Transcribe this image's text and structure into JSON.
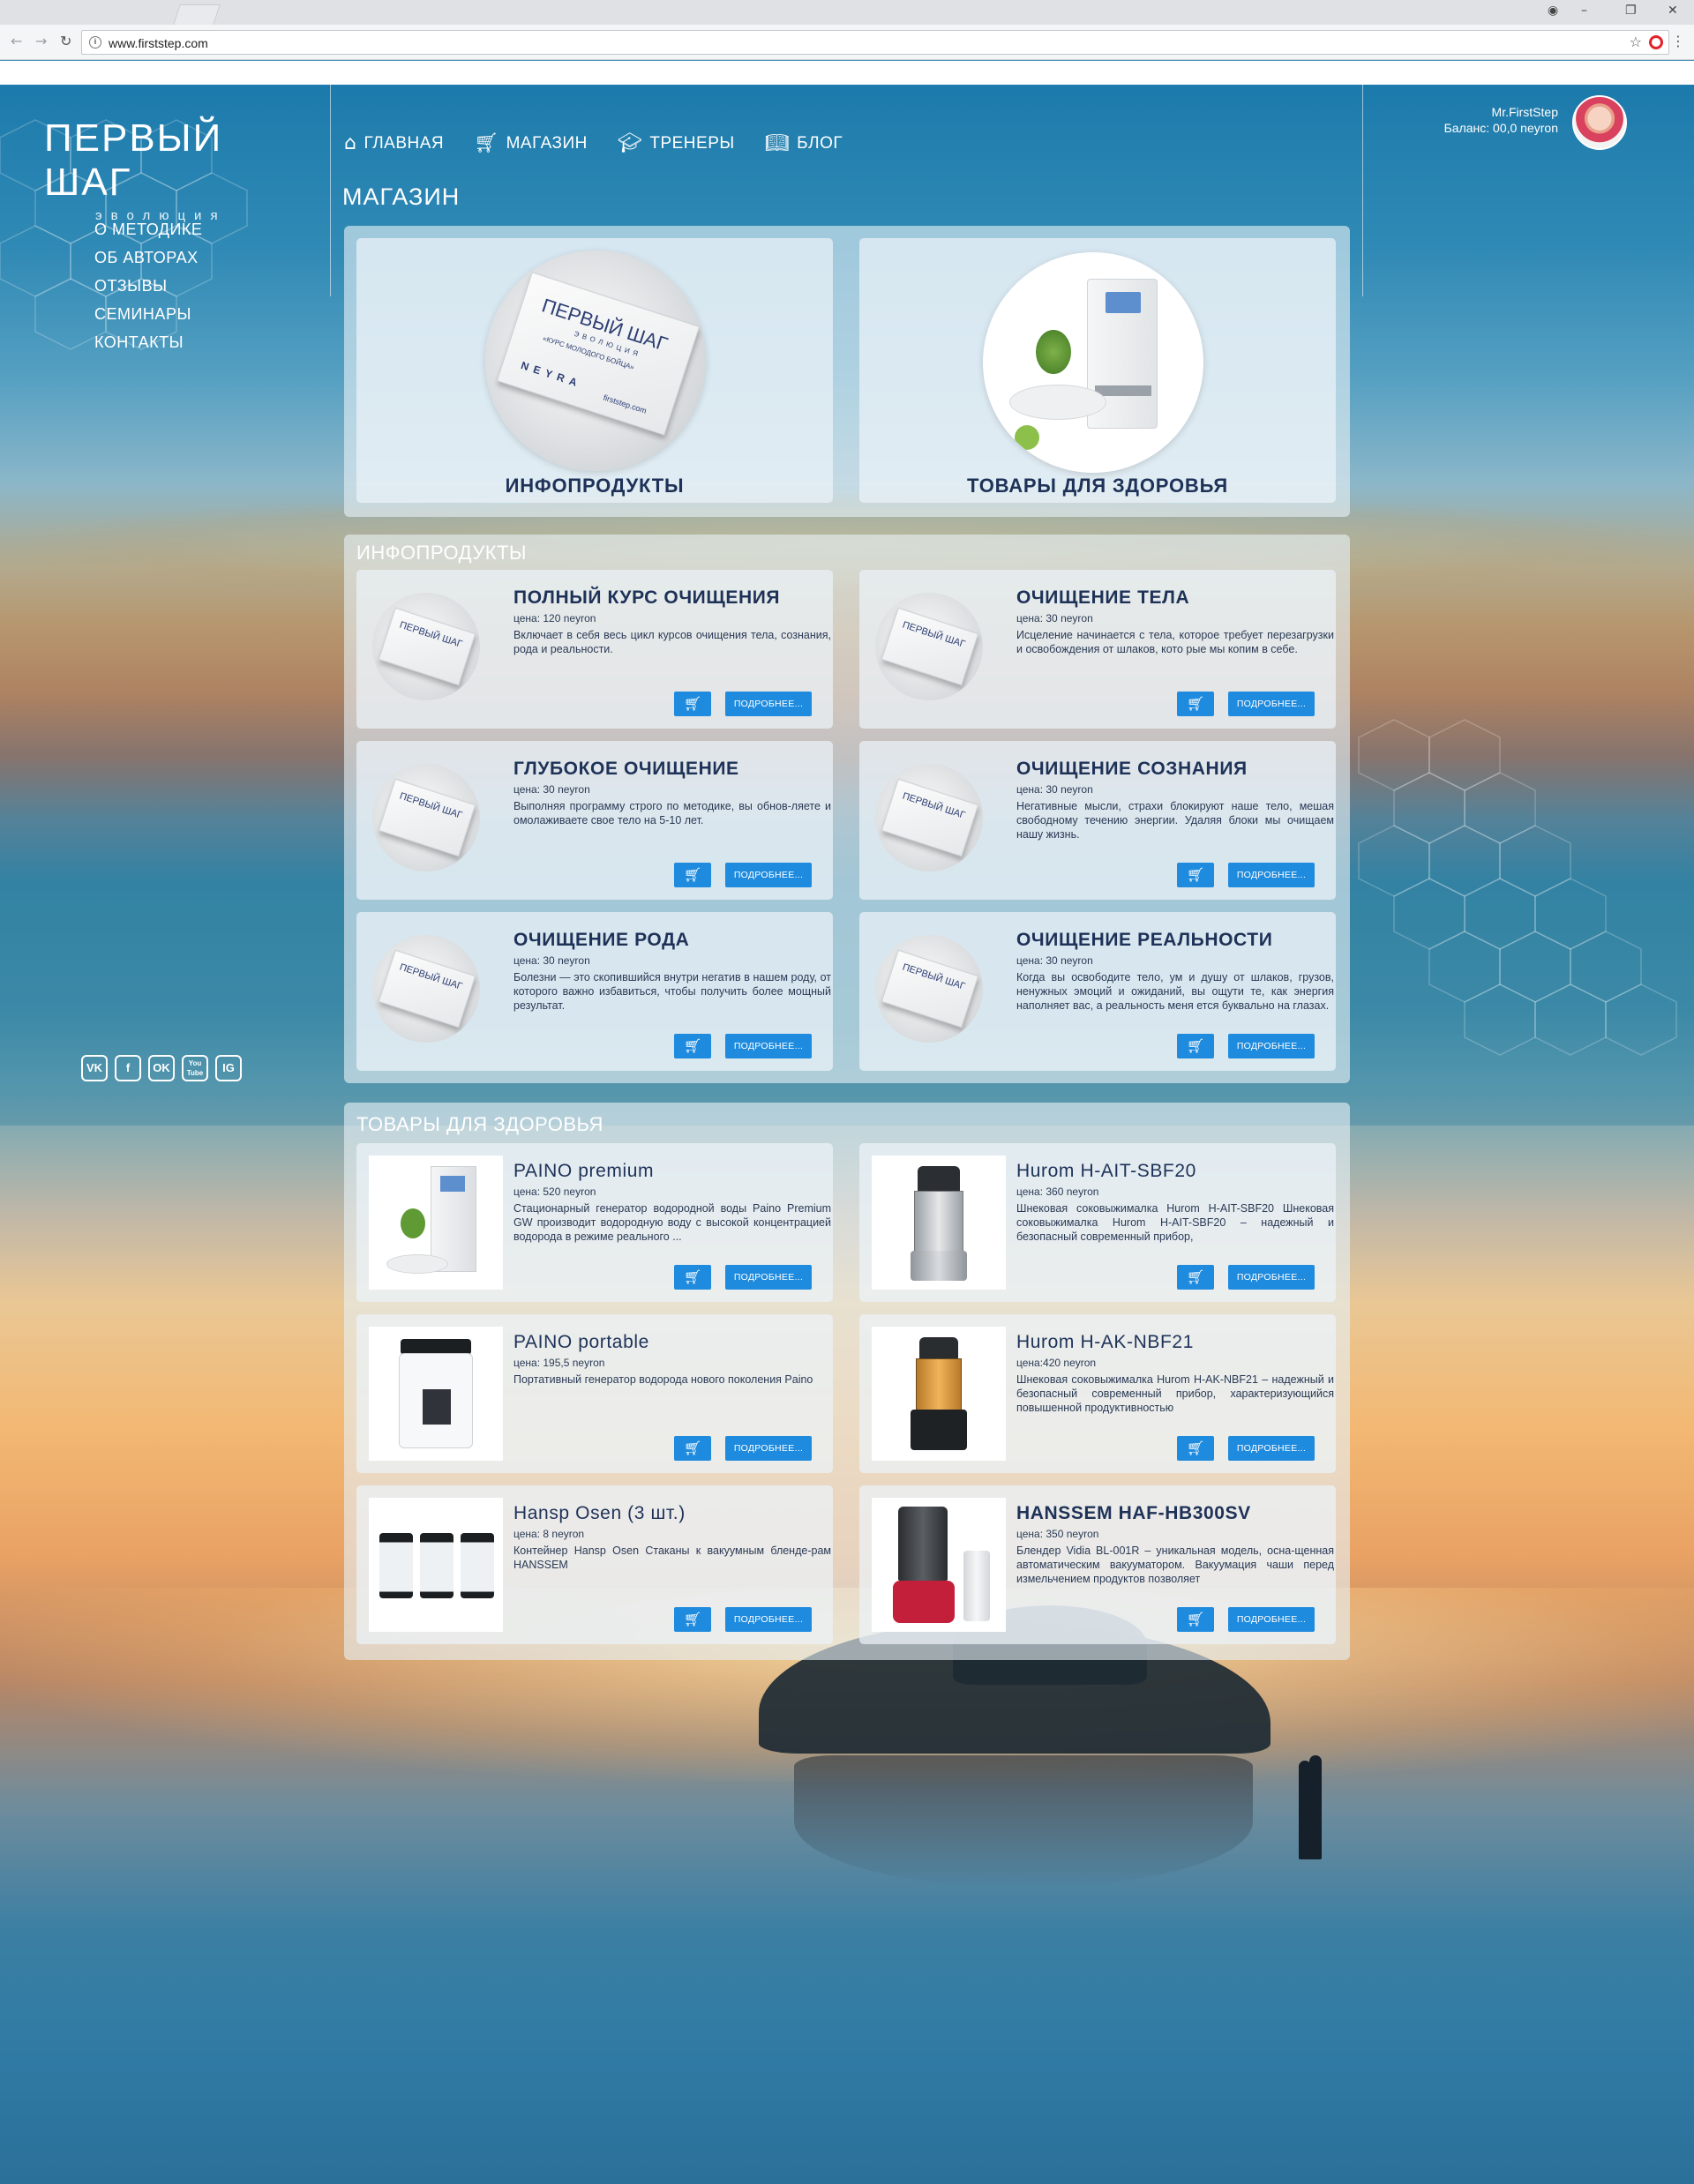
{
  "browser": {
    "url": "www.firststep.com"
  },
  "logo": {
    "title": "ПЕРВЫЙ ШАГ",
    "subtitle": "эволюция"
  },
  "side_nav": [
    "О МЕТОДИКЕ",
    "ОБ АВТОРАХ",
    "ОТЗЫВЫ",
    "СЕМИНАРЫ",
    "КОНТАКТЫ"
  ],
  "top_nav": [
    {
      "label": "ГЛАВНАЯ",
      "icon": "home-icon"
    },
    {
      "label": "МАГАЗИН",
      "icon": "basket-icon"
    },
    {
      "label": "ТРЕНЕРЫ",
      "icon": "graduation-cap-icon"
    },
    {
      "label": "БЛОГ",
      "icon": "book-icon"
    }
  ],
  "user": {
    "name": "Mr.FirstStep",
    "balance": "Баланс: 00,0 neyron"
  },
  "page_title": "МАГАЗИН",
  "categories": [
    {
      "label": "ИНФОПРОДУКТЫ"
    },
    {
      "label": "ТОВАРЫ ДЛЯ ЗДОРОВЬЯ"
    }
  ],
  "box_label": {
    "brand": "ПЕРВЫЙ ШАГ",
    "sub": "ЭВОЛЮЦИЯ",
    "course": "«КУРС МОЛОДОГО БОЙЦА»",
    "side": "NEYRA",
    "site": "firststep.com"
  },
  "infoproducts": {
    "title": "ИНФОПРОДУКТЫ",
    "items": [
      {
        "name": "ПОЛНЫЙ КУРС ОЧИЩЕНИЯ",
        "price": "цена: 120 neyron",
        "desc": "Включает в себя весь цикл курсов очищения тела, сознания, рода и реальности."
      },
      {
        "name": "ОЧИЩЕНИЕ ТЕЛА",
        "price": "цена: 30 neyron",
        "desc": "Исцеление начинается с тела, которое требует перезагрузки и освобождения от шлаков, кото рые мы копим в себе."
      },
      {
        "name": "ГЛУБОКОЕ ОЧИЩЕНИЕ",
        "price": "цена: 30 neyron",
        "desc": "Выполняя программу строго по методике, вы обнов-ляете и омолаживаете свое тело на 5-10 лет."
      },
      {
        "name": "ОЧИЩЕНИЕ СОЗНАНИЯ",
        "price": "цена: 30 neyron",
        "desc": "Негативные мысли, страхи блокируют наше тело, мешая свободному течению энергии. Удаляя блоки мы очищаем нашу жизнь."
      },
      {
        "name": "ОЧИЩЕНИЕ РОДА",
        "price": "цена: 30 neyron",
        "desc": "Болезни — это скопившийся внутри негатив в нашем роду, от которого важно избавиться, чтобы получить более мощный результат."
      },
      {
        "name": "ОЧИЩЕНИЕ РЕАЛЬНОСТИ",
        "price": "цена: 30 neyron",
        "desc": "Когда вы освободите тело, ум и душу от шлаков, грузов, ненужных эмоций и ожиданий, вы ощути те, как энергия наполняет вас, а реальность меня ется буквально на глазах."
      }
    ]
  },
  "health": {
    "title": "ТОВАРЫ ДЛЯ ЗДОРОВЬЯ",
    "items": [
      {
        "name": "PAINO premium",
        "price": "цена: 520 neyron",
        "desc": "Стационарный генератор водородной воды Paino Premium GW производит водородную воду с высокой концентрацией водорода в режиме реального ...",
        "img": "water-generator"
      },
      {
        "name": "Hurom H-AIT-SBF20",
        "price": "цена: 360 neyron",
        "desc": "Шнековая соковыжималка Hurom H-AIT-SBF20 Шнековая соковыжималка Hurom H-AIT-SBF20 – надежный и безопасный современный прибор,",
        "img": "juicer-silver"
      },
      {
        "name": "PAINO portable",
        "price": "цена: 195,5  neyron",
        "desc": "Портативный генератор водорода нового поколения Paino",
        "img": "portable-generator"
      },
      {
        "name": "Hurom H-AK-NBF21",
        "price": "цена:420 neyron",
        "desc": "Шнековая соковыжималка Hurom H-AK-NBF21 – надежный и безопасный современный прибор, характеризующийся повышенной продуктивностью",
        "img": "juicer-black"
      },
      {
        "name": "Hansp Osen (3 шт.)",
        "price": "цена: 8 neyron",
        "desc": "Контейнер Hansp Osen Стаканы к вакуумным бленде-рам HANSSEM",
        "img": "containers"
      },
      {
        "name": "HANSSEM HAF-HB300SV",
        "price": "цена: 350 neyron",
        "desc": "Блендер Vidia BL-001R – уникальная модель, осна-щенная автоматическим вакууматором. Вакуумация чаши перед измельчением продуктов позволяет",
        "img": "blender-red"
      }
    ]
  },
  "buttons": {
    "cart_icon": "cart-plus-icon",
    "more_label": "ПОДРОБНЕЕ..."
  },
  "social": [
    "VK",
    "f",
    "OK",
    "You Tube",
    "IG"
  ]
}
